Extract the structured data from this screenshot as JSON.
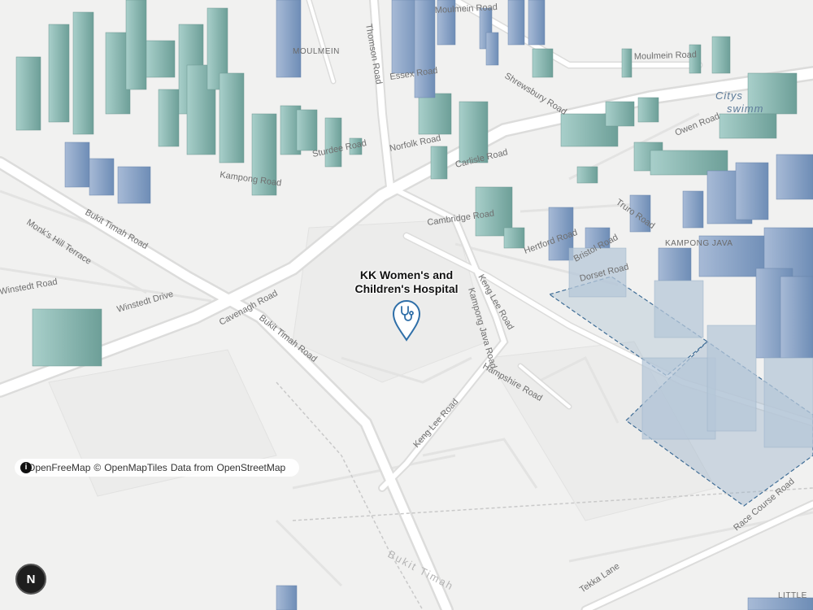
{
  "poi": {
    "name_line1": "KK Women's and",
    "name_line2": "Children's Hospital",
    "icon": "stethoscope-icon",
    "marker_color": "#2f6fa8"
  },
  "roads": [
    "Bukit Timah Road",
    "Bukit Timah Road",
    "Cavenagh Road",
    "Winstedt Drive",
    "Winstedt Road",
    "Monk's Hill Terrace",
    "Kampong Java Road",
    "Keng Lee Road",
    "Keng Lee Road",
    "Hampshire Road",
    "Race Course Road",
    "Tekka Lane",
    "Cambridge Road",
    "Carlisle Road",
    "Norfolk Road",
    "Dorset Road",
    "Bristol Road",
    "Hertford Road",
    "Owen Road",
    "Truro Road",
    "Kampong Road",
    "Sturdee Road",
    "Essex Road",
    "Thomson Road",
    "Moulmein Road",
    "Moulmein Road",
    "Shrewsbury Road",
    "Bukit Timah"
  ],
  "areas": [
    "KAMPONG JAVA",
    "MOULMEIN",
    "LITTLE"
  ],
  "water": [
    "Citys",
    "swimm"
  ],
  "attribution": {
    "info_icon": "i",
    "openfreemap": "OpenFreeMap",
    "copyright": "©",
    "openmaptiles": "OpenMapTiles",
    "data_from": "Data from",
    "openstreetmap": "OpenStreetMap"
  },
  "navigation_button": {
    "label": "N"
  },
  "colors": {
    "land": "#f1f1f0",
    "road": "#ffffff",
    "building_teal": "#7fb3ad",
    "building_blue": "#7f9dc2",
    "construction_area": "#9fb6cc"
  }
}
